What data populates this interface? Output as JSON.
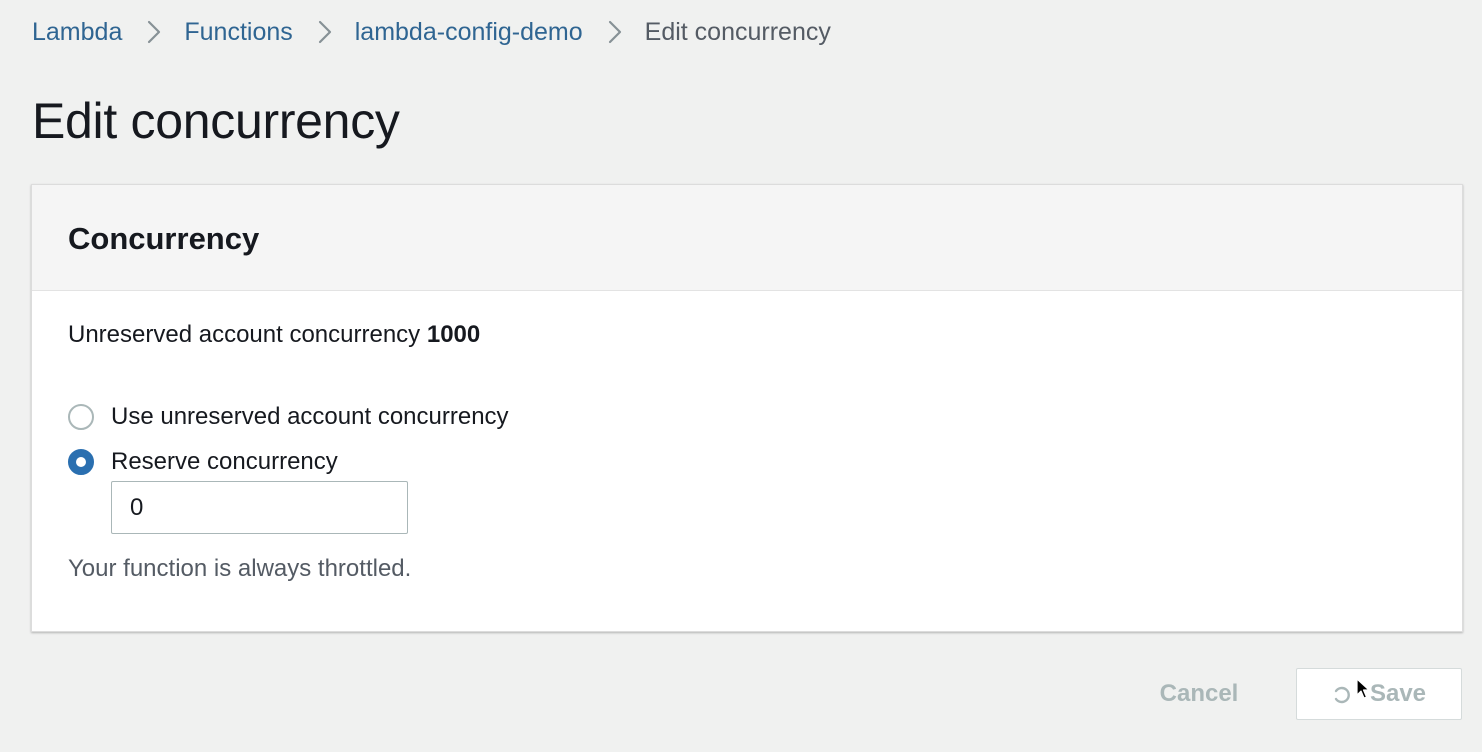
{
  "breadcrumb": {
    "items": [
      {
        "label": "Lambda"
      },
      {
        "label": "Functions"
      },
      {
        "label": "lambda-config-demo"
      }
    ],
    "current": "Edit concurrency",
    "separator_icon": "chevron-right-icon"
  },
  "page": {
    "title": "Edit concurrency"
  },
  "concurrency_panel": {
    "title": "Concurrency",
    "unreserved_label": "Unreserved account concurrency",
    "unreserved_value": "1000",
    "options": [
      {
        "label": "Use unreserved account concurrency",
        "selected": false
      },
      {
        "label": "Reserve concurrency",
        "selected": true
      }
    ],
    "reserve_input_value": "0",
    "hint": "Your function is always throttled."
  },
  "actions": {
    "cancel_label": "Cancel",
    "save_label": "Save",
    "save_loading_icon": "spinner-icon"
  },
  "colors": {
    "link": "#2f6592",
    "radio_selected": "#2a6fb0",
    "disabled_text": "#aab7b8",
    "page_background": "#f0f1f0"
  }
}
